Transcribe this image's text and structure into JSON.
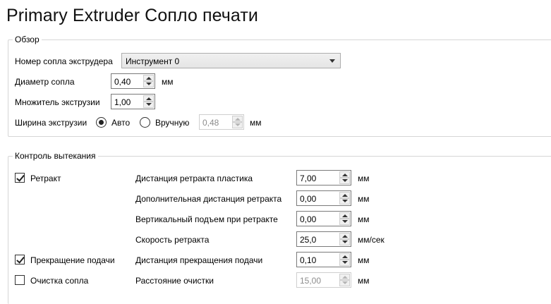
{
  "title": "Primary Extruder Сопло печати",
  "overview": {
    "legend": "Обзор",
    "nozzle_number_label": "Номер сопла экструдера",
    "nozzle_number_value": "Инструмент 0",
    "diameter_label": "Диаметр сопла",
    "diameter_value": "0,40",
    "diameter_unit": "мм",
    "multiplier_label": "Множитель экструзии",
    "multiplier_value": "1,00",
    "width_label": "Ширина экструзии",
    "width_auto_label": "Авто",
    "width_auto_selected": true,
    "width_manual_label": "Вручную",
    "width_manual_value": "0,48",
    "width_unit": "мм"
  },
  "leak": {
    "legend": "Контроль вытекания",
    "retract": {
      "label": "Ретракт",
      "checked": true,
      "fields": [
        {
          "label": "Дистанция ретракта пластика",
          "value": "7,00",
          "unit": "мм"
        },
        {
          "label": "Дополнительная дистанция ретракта",
          "value": "0,00",
          "unit": "мм"
        },
        {
          "label": "Вертикальный подъем при ретракте",
          "value": "0,00",
          "unit": "мм"
        },
        {
          "label": "Скорость ретракта",
          "value": "25,0",
          "unit": "мм/сек"
        }
      ]
    },
    "coast": {
      "label": "Прекращение подачи",
      "checked": true,
      "field_label": "Дистанция прекращения подачи",
      "field_value": "0,10",
      "field_unit": "мм"
    },
    "wipe": {
      "label": "Очистка сопла",
      "checked": false,
      "field_label": "Расстояние очистки",
      "field_value": "15,00",
      "field_unit": "мм"
    }
  }
}
